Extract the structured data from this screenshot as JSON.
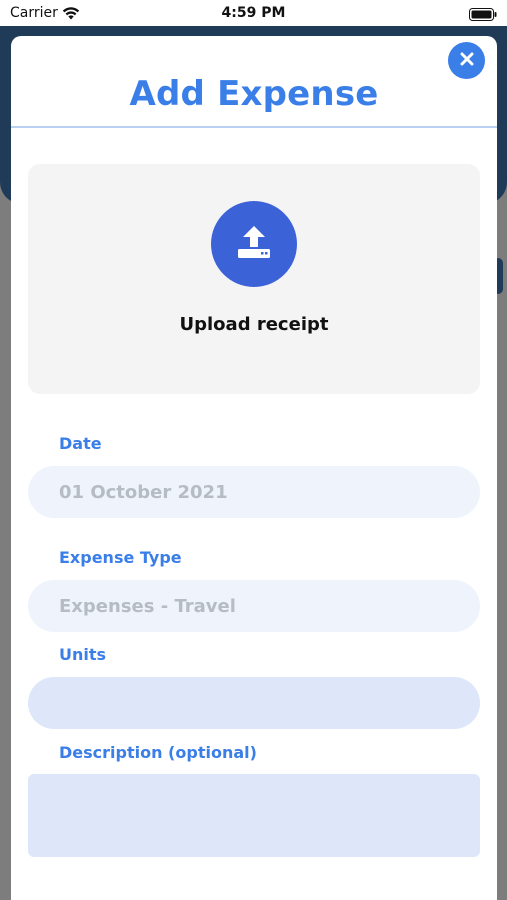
{
  "status_bar": {
    "carrier": "Carrier",
    "time": "4:59 PM"
  },
  "modal": {
    "title": "Add Expense",
    "close_icon": "close-icon"
  },
  "upload": {
    "label": "Upload receipt",
    "icon": "upload-icon"
  },
  "form": {
    "date": {
      "label": "Date",
      "value": "01 October 2021"
    },
    "expense_type": {
      "label": "Expense Type",
      "value": "Expenses - Travel"
    },
    "units": {
      "label": "Units",
      "value": ""
    },
    "description": {
      "label": "Description (optional)",
      "value": ""
    }
  },
  "colors": {
    "accent": "#3a7ee8",
    "upload_circle": "#3c62d7",
    "field_filled_bg": "#eff4fc",
    "field_empty_bg": "#dde7f9",
    "background_header": "#1f3b57"
  }
}
